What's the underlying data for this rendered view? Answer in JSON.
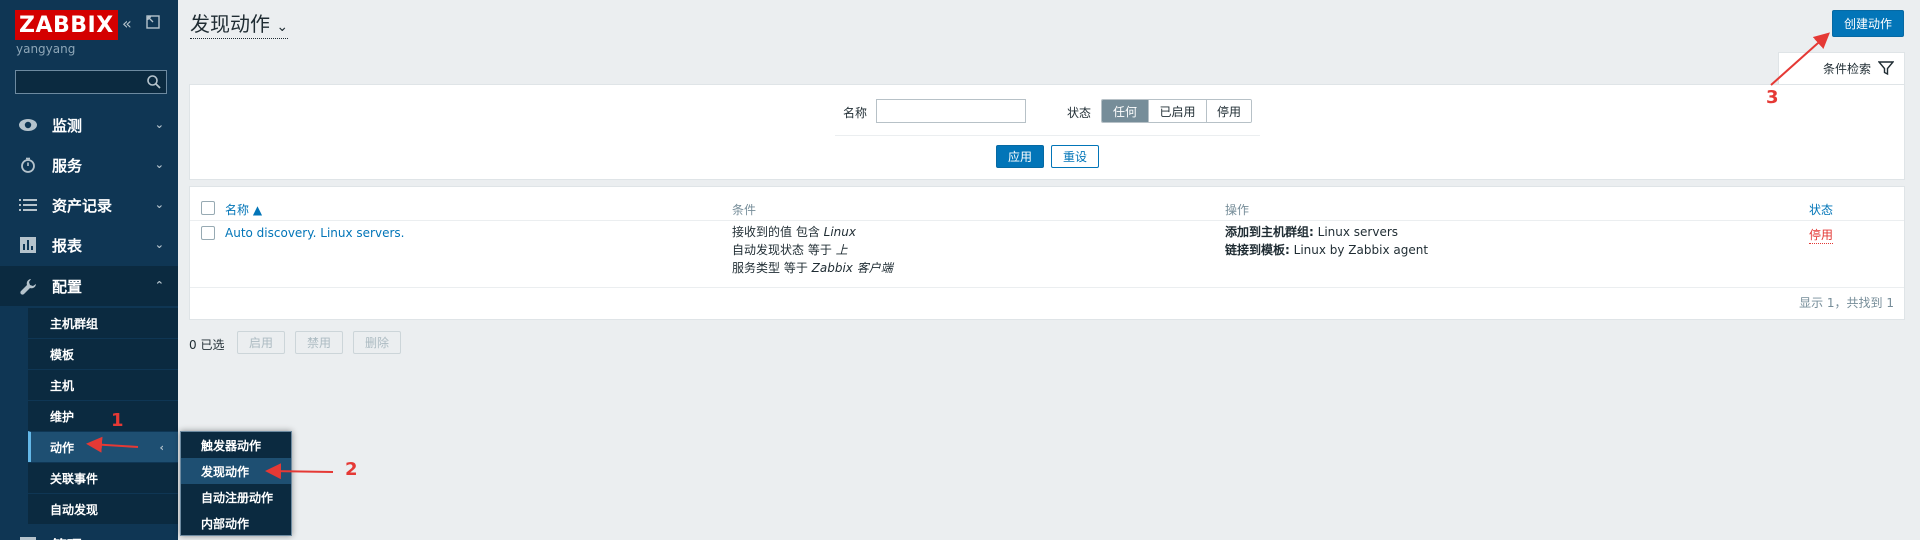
{
  "sidebar": {
    "logo": "ZABBIX",
    "username": "yangyang",
    "search_placeholder": "",
    "nav": [
      {
        "label": "监测",
        "icon": "eye-icon"
      },
      {
        "label": "服务",
        "icon": "clock-icon"
      },
      {
        "label": "资产记录",
        "icon": "list-icon"
      },
      {
        "label": "报表",
        "icon": "bar-chart-icon"
      },
      {
        "label": "配置",
        "icon": "wrench-icon"
      },
      {
        "label": "管理",
        "icon": "gear-icon"
      }
    ],
    "config_submenu": [
      "主机群组",
      "模板",
      "主机",
      "维护",
      "动作",
      "关联事件",
      "自动发现"
    ],
    "actions_flyout": [
      "触发器动作",
      "发现动作",
      "自动注册动作",
      "内部动作"
    ]
  },
  "header": {
    "title": "发现动作",
    "create_button": "创建动作"
  },
  "filter": {
    "tab_label": "条件检索",
    "name_label": "名称",
    "name_value": "",
    "status_label": "状态",
    "status_options": [
      "任何",
      "已启用",
      "停用"
    ],
    "selected_status": "任何",
    "apply": "应用",
    "reset": "重设"
  },
  "table": {
    "columns": [
      "名称 ▲",
      "条件",
      "操作",
      "状态"
    ],
    "rows": [
      {
        "name": "Auto discovery. Linux servers.",
        "conditions": [
          {
            "prefix": "接收到的值 包含 ",
            "value": "Linux"
          },
          {
            "prefix": "自动发现状态 等于 ",
            "value": "上"
          },
          {
            "prefix": "服务类型 等于 ",
            "value": "Zabbix 客户端"
          }
        ],
        "operations": [
          {
            "label": "添加到主机群组:",
            "value": " Linux servers"
          },
          {
            "label": "链接到模板:",
            "value": " Linux by Zabbix agent"
          }
        ],
        "status": "停用"
      }
    ],
    "footer": "显示 1，共找到 1"
  },
  "bulk": {
    "selected": "0 已选",
    "enable": "启用",
    "disable": "禁用",
    "delete": "删除"
  },
  "annotations": [
    "1",
    "2",
    "3"
  ],
  "colors": {
    "sidebar": "#0f3654",
    "accent": "#0275b8",
    "logo": "#d40000",
    "annotation": "#e53935",
    "disabled_status": "#e33734"
  }
}
